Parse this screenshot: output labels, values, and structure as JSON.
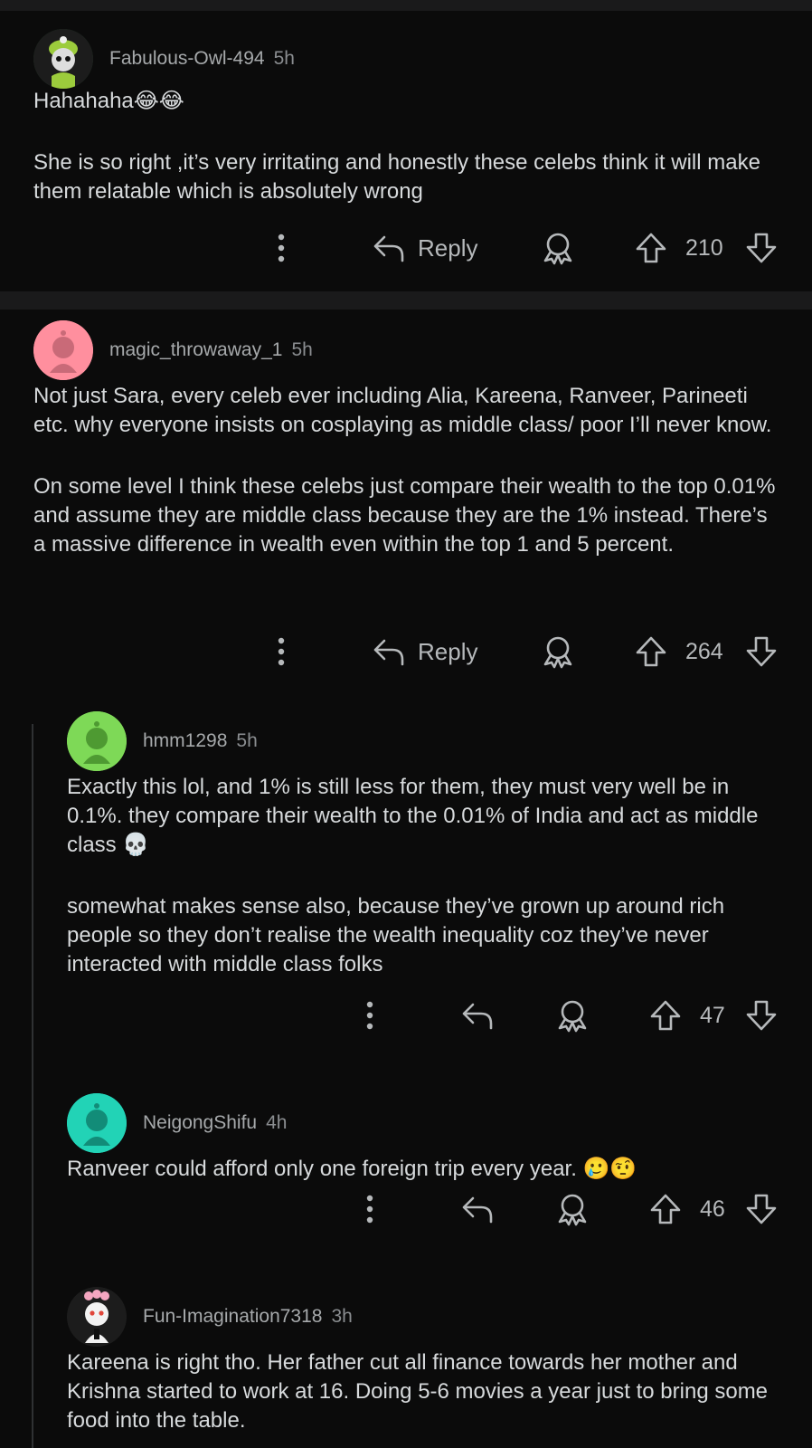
{
  "comments": [
    {
      "username": "Fabulous-Owl-494",
      "age": "5h",
      "paragraphs": [
        "Hahahaha😂😂",
        "She is so right ,it’s very irritating and honestly these celebs think it will make them relatable which is absolutely wrong"
      ],
      "reply_label": "Reply",
      "votes": "210",
      "avatar_color": "#1f3b25"
    },
    {
      "username": "magic_throwaway_1",
      "age": "5h",
      "paragraphs": [
        "Not just Sara, every celeb ever including Alia, Kareena, Ranveer, Parineeti etc. why everyone insists on cosplaying as middle class/ poor I’ll never know.",
        "On some level I think these celebs just compare their wealth to the top 0.01% and assume they are middle class because they are the 1% instead. There’s a massive difference in wealth even within the top 1 and 5 percent."
      ],
      "reply_label": "Reply",
      "votes": "264",
      "avatar_color": "#ff8f9e"
    },
    {
      "username": "hmm1298",
      "age": "5h",
      "paragraphs": [
        "Exactly this lol, and 1% is still less for them, they must very well be in 0.1%.  they compare their wealth to the 0.01% of India and act as middle class 💀",
        "somewhat makes sense also,  because they’ve grown up around rich people so they don’t realise the wealth inequality coz they’ve never interacted with middle class folks"
      ],
      "votes": "47",
      "avatar_color": "#7ed957"
    },
    {
      "username": "NeigongShifu",
      "age": "4h",
      "paragraphs": [
        "Ranveer could afford only one foreign trip every year. 🥲🤨"
      ],
      "votes": "46",
      "avatar_color": "#22d3b6"
    },
    {
      "username": "Fun-Imagination7318",
      "age": "3h",
      "paragraphs": [
        "Kareena is right tho. Her father cut all finance towards her mother and Krishna started to work at 16. Doing 5-6 movies a year just to bring some food into the table."
      ],
      "avatar_color": "#1c1c1c"
    }
  ],
  "icons": {
    "more": "more-options-icon",
    "reply": "reply-arrow-icon",
    "award": "award-icon",
    "upvote": "upvote-arrow-icon",
    "downvote": "downvote-arrow-icon"
  }
}
